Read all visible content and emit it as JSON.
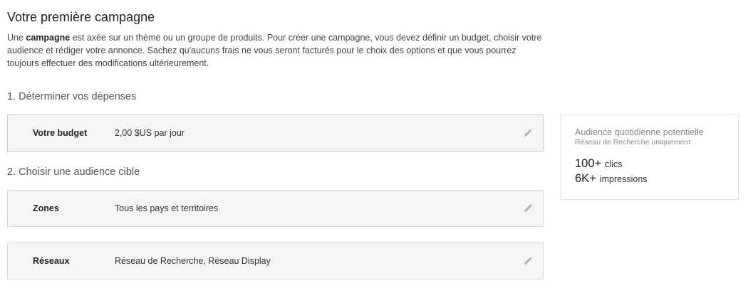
{
  "page": {
    "title": "Votre première campagne",
    "intro": {
      "prefix": "Une ",
      "bold": "campagne",
      "rest": " est axée sur un thème ou un groupe de produits. Pour créer une campagne, vous devez définir un budget, choisir votre audience et rédiger votre annonce. Sachez qu'aucuns frais ne vous seront facturés pour le choix des options et que vous pourrez toujours effectuer des modifications ultérieurement."
    }
  },
  "sections": {
    "spending": {
      "heading": "1. Déterminer vos dépenses",
      "budget": {
        "label": "Votre budget",
        "value": "2,00 $US par jour",
        "edit_icon": "pencil-icon"
      }
    },
    "audience": {
      "heading": "2. Choisir une audience cible",
      "zones": {
        "label": "Zones",
        "value": "Tous les pays et territoires",
        "edit_icon": "pencil-icon"
      },
      "networks": {
        "label": "Réseaux",
        "value": "Réseau de Recherche, Réseau Display",
        "edit_icon": "pencil-icon"
      }
    }
  },
  "sidebar": {
    "title": "Audience quotidienne potentielle",
    "subtitle": "Réseau de Recherche uniquement",
    "clicks": {
      "value": "100+",
      "unit": "clics"
    },
    "impressions": {
      "value": "6K+",
      "unit": "impressions"
    }
  },
  "colors": {
    "card_background": "#f5f5f5",
    "card_border": "#d9d9d9",
    "icon": "#b3b3b3"
  }
}
